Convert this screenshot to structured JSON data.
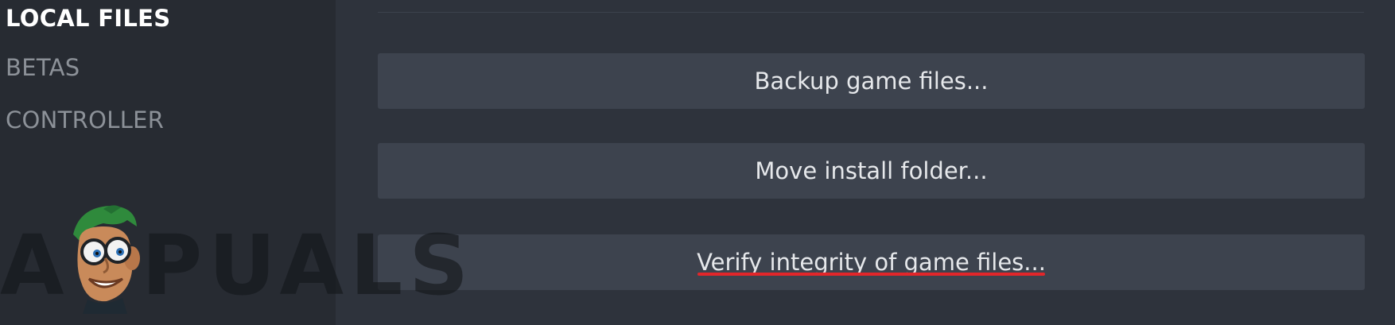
{
  "sidebar": {
    "items": [
      {
        "label": "LOCAL FILES",
        "active": true
      },
      {
        "label": "BETAS",
        "active": false
      },
      {
        "label": "CONTROLLER",
        "active": false
      }
    ]
  },
  "main": {
    "buttons": [
      {
        "label": "Backup game files..."
      },
      {
        "label": "Move install folder..."
      },
      {
        "label": "Verify integrity of game files..."
      }
    ]
  },
  "watermark": {
    "text_first": "A",
    "text_rest": "PUALS",
    "mascot_icon": "appuals-mascot-icon"
  },
  "colors": {
    "sidebar_bg": "#272b32",
    "content_bg": "#2e333c",
    "button_bg": "#3d434e",
    "active_text": "#ffffff",
    "inactive_text": "#8c9198",
    "highlight_underline": "#e2262a"
  }
}
